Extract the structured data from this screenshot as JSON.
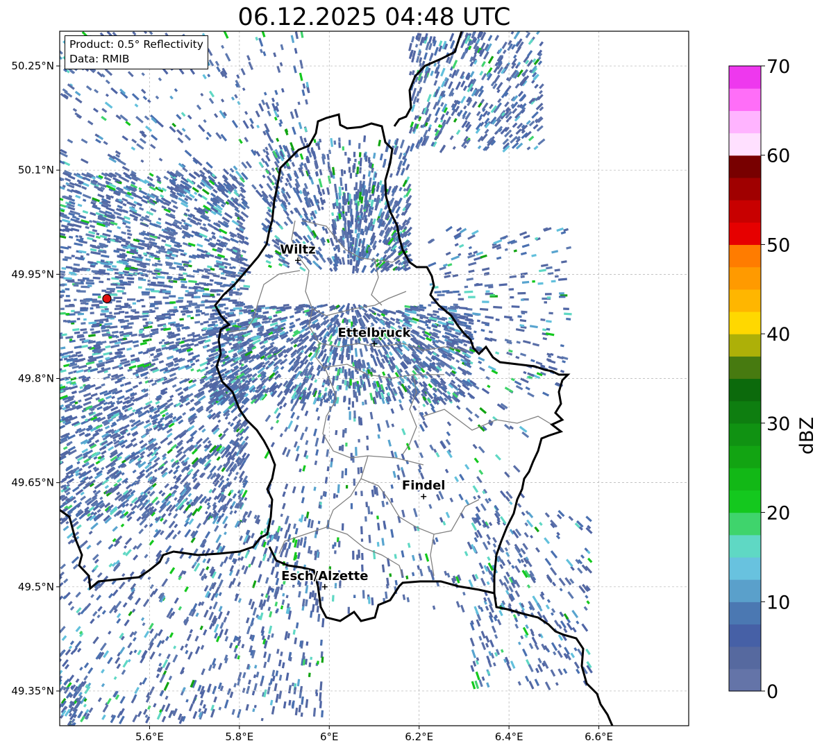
{
  "title": "06.12.2025 04:48 UTC",
  "info": {
    "product": "Product: 0.5° Reflectivity",
    "data_source": "Data: RMIB"
  },
  "map": {
    "lon_range": [
      5.4,
      6.8
    ],
    "lat_range": [
      49.3,
      50.3
    ],
    "lon_ticks": [
      {
        "value": 5.6,
        "label": "5.6°E"
      },
      {
        "value": 5.8,
        "label": "5.8°E"
      },
      {
        "value": 6.0,
        "label": "6°E"
      },
      {
        "value": 6.2,
        "label": "6.2°E"
      },
      {
        "value": 6.4,
        "label": "6.4°E"
      },
      {
        "value": 6.6,
        "label": "6.6°E"
      }
    ],
    "lat_ticks": [
      {
        "value": 50.25,
        "label": "50.25°N"
      },
      {
        "value": 50.1,
        "label": "50.1°N"
      },
      {
        "value": 49.95,
        "label": "49.95°N"
      },
      {
        "value": 49.8,
        "label": "49.8°N"
      },
      {
        "value": 49.65,
        "label": "49.65°N"
      },
      {
        "value": 49.5,
        "label": "49.5°N"
      },
      {
        "value": 49.35,
        "label": "49.35°N"
      }
    ],
    "cities": [
      {
        "name": "Wiltz",
        "lon": 5.93,
        "lat": 49.97
      },
      {
        "name": "Ettelbruck",
        "lon": 6.1,
        "lat": 49.85
      },
      {
        "name": "Findel",
        "lon": 6.21,
        "lat": 49.63
      },
      {
        "name": "Esch/Alzette",
        "lon": 5.99,
        "lat": 49.5
      }
    ],
    "radar_site": {
      "lon": 5.505,
      "lat": 49.915,
      "color": "#e01010"
    },
    "colors": {
      "border": "#000000",
      "canton": "#808080",
      "grid": "#b0b0b0"
    }
  },
  "colorbar": {
    "label": "dBZ",
    "vmin": 0,
    "vmax": 70,
    "ticks": [
      0,
      10,
      20,
      30,
      40,
      50,
      60,
      70
    ],
    "colors": [
      "#6474a8",
      "#56699f",
      "#4660a6",
      "#4b78b2",
      "#5aa0cb",
      "#68c2df",
      "#5fd8c4",
      "#3fd46c",
      "#14c81e",
      "#12b816",
      "#12a412",
      "#109212",
      "#0e7e10",
      "#0c6a0c",
      "#477a10",
      "#adb008",
      "#ffd800",
      "#ffb600",
      "#ff9a00",
      "#ff7c00",
      "#e60000",
      "#c80000",
      "#a00000",
      "#780000",
      "#ffe0ff",
      "#ffb4ff",
      "#ff6ef8",
      "#ee38ee"
    ]
  }
}
